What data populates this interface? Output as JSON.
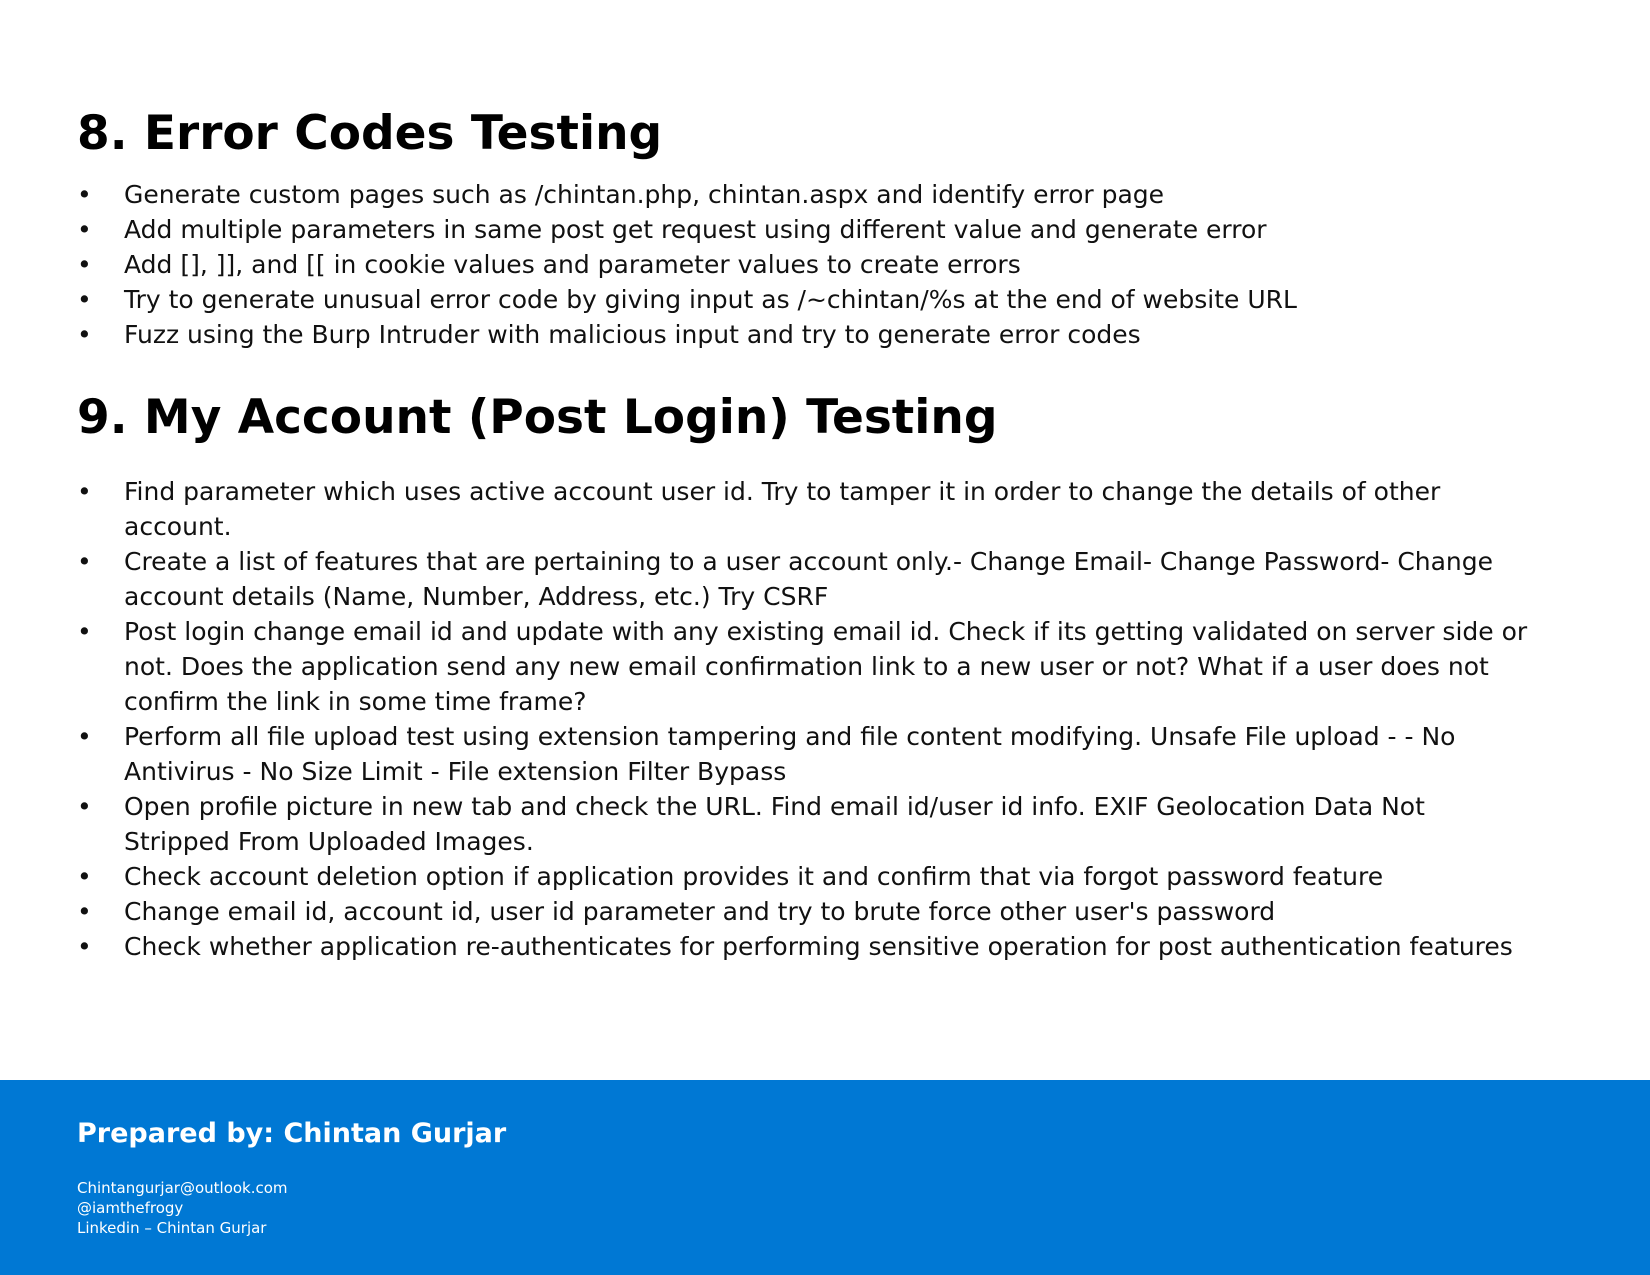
{
  "sections": [
    {
      "title": "8. Error Codes Testing",
      "items": [
        "Generate custom pages such as /chintan.php, chintan.aspx and identify error page",
        "Add multiple parameters in same post get request using different value and generate error",
        "Add [], ]], and [[ in cookie values and parameter values to create errors",
        "Try to generate unusual error code by giving input as /~chintan/%s at the end of website URL",
        "Fuzz using the Burp Intruder with malicious input and try to generate error codes"
      ]
    },
    {
      "title": "9. My Account (Post Login) Testing",
      "items": [
        "Find parameter which uses active account user id. Try to tamper it in order to change the details of other account.",
        "Create a list of features that are pertaining to a user account only.- Change Email- Change Password- Change account details (Name, Number, Address, etc.) Try CSRF",
        "Post login change email id and update with any existing email id. Check if its getting validated on server side or not. Does the application send any new email confirmation link to a new user or not? What if a user does not confirm the link in some time frame?",
        "Perform all file upload test using extension tampering and file content modifying. Unsafe File upload -  - No Antivirus - No Size Limit - File extension Filter Bypass",
        "Open profile picture in new tab and check the URL. Find email id/user id info. EXIF Geolocation Data Not Stripped From Uploaded Images.",
        "Check account deletion option if application provides it and confirm that via forgot password feature",
        "Change email id, account id, user id parameter and try to brute force other user's password",
        "Check whether application re-authenticates for performing sensitive operation for post authentication features"
      ]
    }
  ],
  "bullet_symbol": "•",
  "footer": {
    "prepared_by": "Prepared by: Chintan Gurjar",
    "email": "Chintangurjar@outlook.com",
    "handle": "@iamthefrogy",
    "linkedin": "Linkedin – Chintan Gurjar",
    "background_color": "#0078d4"
  }
}
